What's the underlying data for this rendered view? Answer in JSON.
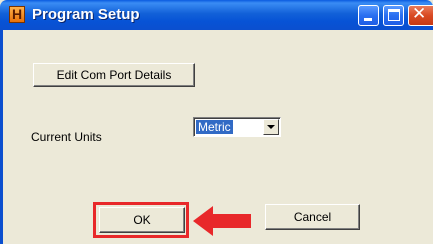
{
  "window": {
    "title": "Program Setup",
    "app_icon_letter": "H"
  },
  "buttons": {
    "com_port": "Edit Com Port Details",
    "ok": "OK",
    "cancel": "Cancel"
  },
  "units": {
    "label": "Current Units",
    "selected": "Metric"
  },
  "colors": {
    "highlight": "#e8282a",
    "titlebar": "#0b4fcf"
  }
}
